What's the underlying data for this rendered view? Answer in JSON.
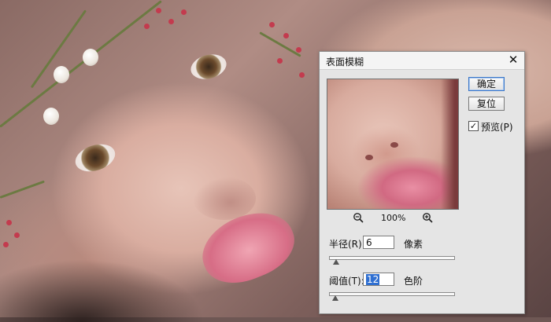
{
  "dialog": {
    "title": "表面模糊",
    "close_icon": "close-icon",
    "buttons": {
      "ok": "确定",
      "reset": "复位"
    },
    "preview_checkbox": {
      "label": "预览(P)",
      "checked": true
    },
    "zoom": {
      "level": "100%",
      "zoom_out_icon": "zoom-out-icon",
      "zoom_in_icon": "zoom-in-icon"
    },
    "radius": {
      "label": "半径(R):",
      "value": "6",
      "unit": "像素",
      "slider_fraction": 0.06
    },
    "threshold": {
      "label": "阈值(T):",
      "value": "12",
      "unit": "色阶",
      "slider_fraction": 0.05
    }
  },
  "colors": {
    "dialog_bg": "#e5e5e5",
    "selection": "#2f6fd1",
    "default_button_border": "#3b77c8"
  }
}
